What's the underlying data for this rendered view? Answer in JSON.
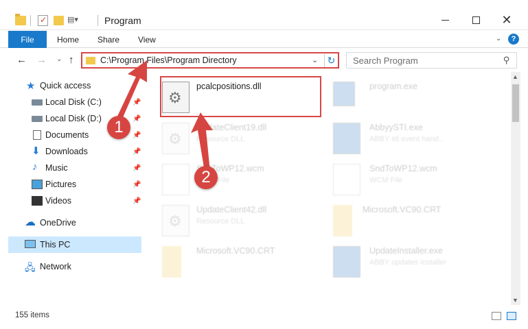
{
  "window": {
    "title": "Program",
    "customize_glyph": "▤▾"
  },
  "ribbon": {
    "tabs": [
      "File",
      "Home",
      "Share",
      "View"
    ],
    "expand_glyph": "⌄",
    "help_glyph": "?"
  },
  "navigation": {
    "back_glyph": "←",
    "forward_glyph": "→",
    "recent_glyph": "⌄",
    "up_glyph": "↑",
    "address": "C:\\Program Files\\Program Directory",
    "address_dropdown_glyph": "⌄",
    "refresh_glyph": "↻",
    "search_placeholder": "Search Program",
    "search_icon": "magnifier-icon"
  },
  "sidebar": {
    "items": [
      {
        "label": "Quick access",
        "icon": "star-icon",
        "pinned": false
      },
      {
        "label": "Local Disk (C:)",
        "icon": "drive-icon",
        "pinned": true
      },
      {
        "label": "Local Disk (D:)",
        "icon": "drive-icon",
        "pinned": true
      },
      {
        "label": "Documents",
        "icon": "documents-icon",
        "pinned": true
      },
      {
        "label": "Downloads",
        "icon": "download-icon",
        "pinned": true
      },
      {
        "label": "Music",
        "icon": "music-icon",
        "pinned": true
      },
      {
        "label": "Pictures",
        "icon": "pictures-icon",
        "pinned": true
      },
      {
        "label": "Videos",
        "icon": "videos-icon",
        "pinned": true
      },
      {
        "label": "OneDrive",
        "icon": "cloud-icon",
        "pinned": false
      },
      {
        "label": "This PC",
        "icon": "computer-icon",
        "pinned": false,
        "selected": true
      },
      {
        "label": "Network",
        "icon": "network-icon",
        "pinned": false
      }
    ]
  },
  "files": [
    {
      "name": "pcalcpositions.dll",
      "type": "",
      "icon": "dll-icon",
      "highlighted": true
    },
    {
      "name": "program.exe",
      "type": "",
      "icon": "exe-icon",
      "highlighted": false
    },
    {
      "name": "UpdateClient19.dll",
      "type": "Resource DLL",
      "icon": "dll-icon",
      "highlighted": false
    },
    {
      "name": "AbbyySTI.exe",
      "type": "ABBY sti event hand...",
      "icon": "exe-icon",
      "highlighted": false
    },
    {
      "name": "SndToWP12.wcm",
      "type": "WCM File",
      "icon": "file-icon",
      "highlighted": false
    },
    {
      "name": "SndToWP12.wcm",
      "type": "WCM File",
      "icon": "file-icon",
      "highlighted": false
    },
    {
      "name": "UpdateClient42.dll",
      "type": "Resource DLL",
      "icon": "dll-icon",
      "highlighted": false
    },
    {
      "name": "Microsoft.VC90.CRT",
      "type": "",
      "icon": "folder-icon",
      "highlighted": false
    },
    {
      "name": "Microsoft.VC90.CRT",
      "type": "",
      "icon": "folder-icon",
      "highlighted": false
    },
    {
      "name": "UpdateInstaller.exe",
      "type": "ABBY updates installer",
      "icon": "exe-icon",
      "highlighted": false
    }
  ],
  "callouts": [
    "1",
    "2"
  ],
  "status": {
    "item_count": "155 items"
  },
  "colors": {
    "accent": "#1979ca",
    "highlight_border": "#d74646",
    "callout": "#d64541",
    "selected_nav": "#cce8ff"
  }
}
